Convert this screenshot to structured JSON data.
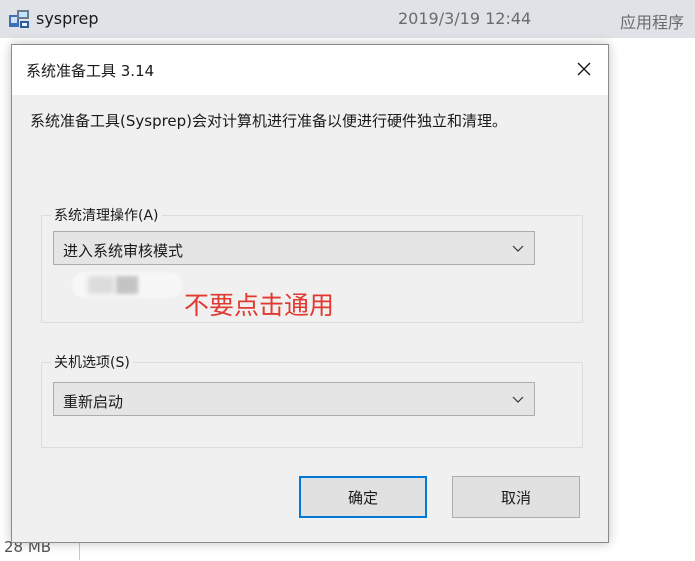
{
  "explorer": {
    "file_name": "sysprep",
    "file_date": "2019/3/19 12:44",
    "file_type": "应用程序",
    "size_fragment": "28 MB"
  },
  "dialog": {
    "title": "系统准备工具 3.14",
    "close_symbol": "×",
    "description": "系统准备工具(Sysprep)会对计算机进行准备以便进行硬件独立和清理。",
    "cleanup_group": {
      "label": "系统清理操作(A)",
      "selected": "进入系统审核模式"
    },
    "annotation": "不要点击通用",
    "shutdown_group": {
      "label": "关机选项(S)",
      "selected": "重新启动"
    },
    "ok_label": "确定",
    "cancel_label": "取消"
  },
  "icons": {
    "file": "application-file-icon",
    "close": "close-icon",
    "dropdown": "chevron-down-icon"
  },
  "colors": {
    "annotation": "#e03a30",
    "focus": "#0078d7"
  }
}
